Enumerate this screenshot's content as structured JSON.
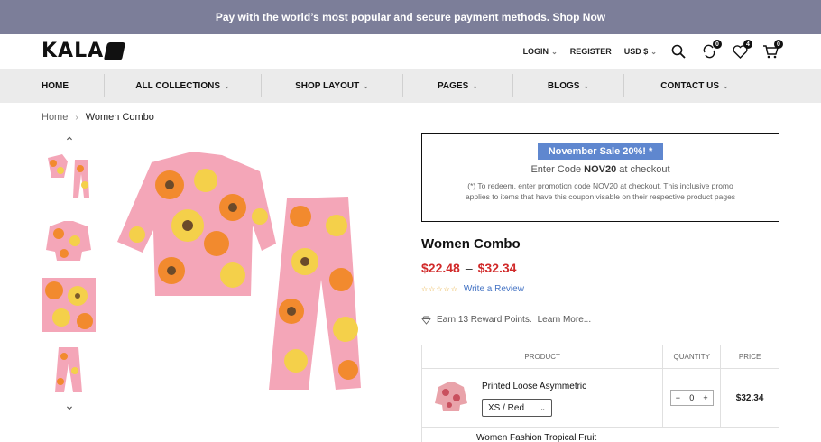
{
  "promo_bar": {
    "text": "Pay with the world’s most popular and secure payment methods. Shop Now"
  },
  "header": {
    "logo_text": "KALA",
    "login": "LOGIN",
    "register": "REGISTER",
    "currency": "USD $",
    "compare_count": "0",
    "wishlist_count": "4",
    "cart_count": "0"
  },
  "nav": {
    "items": [
      {
        "label": "HOME"
      },
      {
        "label": "ALL COLLECTIONS"
      },
      {
        "label": "SHOP LAYOUT"
      },
      {
        "label": "PAGES"
      },
      {
        "label": "BLOGS"
      },
      {
        "label": "CONTACT US"
      }
    ]
  },
  "breadcrumb": {
    "home": "Home",
    "current": "Women Combo"
  },
  "sale": {
    "tag": "November Sale 20%! *",
    "code_prefix": "Enter Code",
    "code": "NOV20",
    "code_suffix": "at checkout",
    "note": "(*) To redeem, enter promotion code NOV20 at checkout. This inclusive promo applies to items that have this coupon visable on their respective product pages"
  },
  "product": {
    "title": "Women Combo",
    "price_min": "$22.48",
    "price_max": "$32.34",
    "price_sep": "–",
    "review_link": "Write a Review",
    "reward_text": "Earn 13 Reward Points.",
    "learn_more": "Learn More..."
  },
  "table": {
    "headers": {
      "product": "PRODUCT",
      "quantity": "QUANTITY",
      "price": "PRICE"
    },
    "rows": [
      {
        "name": "Printed Loose Asymmetric",
        "variant": "XS / Red",
        "qty": "0",
        "price": "$32.34"
      },
      {
        "name": "Women Fashion Tropical Fruit"
      }
    ]
  },
  "colors": {
    "promo_bg": "#7c7e99",
    "sale_tag": "#5f87cf",
    "price_red": "#d12a2a",
    "link_blue": "#4574c4"
  }
}
